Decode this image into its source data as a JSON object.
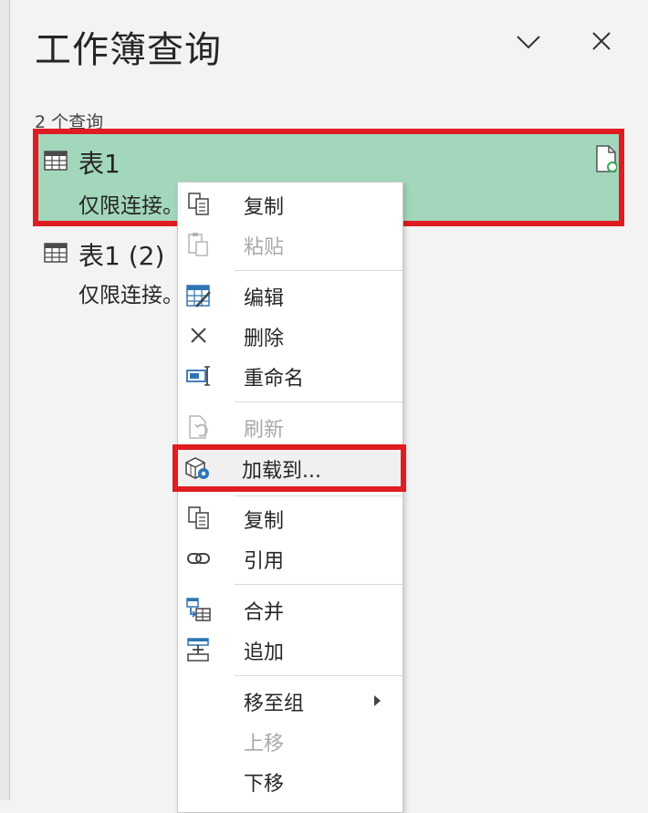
{
  "pane": {
    "title": "工作簿查询",
    "query_count": "2 个查询"
  },
  "queries": [
    {
      "name": "表1",
      "status": "仅限连接。",
      "selected": true
    },
    {
      "name": "表1 (2)",
      "status": "仅限连接。",
      "selected": false
    }
  ],
  "context_menu": {
    "items": [
      {
        "label": "复制",
        "icon": "copy-icon",
        "enabled": true
      },
      {
        "label": "粘贴",
        "icon": "paste-icon",
        "enabled": false
      },
      {
        "label": "编辑",
        "icon": "edit-table-icon",
        "enabled": true
      },
      {
        "label": "删除",
        "icon": "delete-x-icon",
        "enabled": true
      },
      {
        "label": "重命名",
        "icon": "rename-icon",
        "enabled": true
      },
      {
        "label": "刷新",
        "icon": "refresh-icon",
        "enabled": false
      },
      {
        "label": "加载到...",
        "icon": "load-to-icon",
        "enabled": true,
        "highlighted": true
      },
      {
        "label": "复制",
        "icon": "duplicate-icon",
        "enabled": true
      },
      {
        "label": "引用",
        "icon": "reference-link-icon",
        "enabled": true
      },
      {
        "label": "合并",
        "icon": "merge-icon",
        "enabled": true
      },
      {
        "label": "追加",
        "icon": "append-icon",
        "enabled": true
      },
      {
        "label": "移至组",
        "icon": "",
        "enabled": true,
        "has_submenu": true
      },
      {
        "label": "上移",
        "icon": "",
        "enabled": false
      },
      {
        "label": "下移",
        "icon": "",
        "enabled": true
      }
    ]
  },
  "colors": {
    "selected_bg": "#a3d7bb",
    "highlight_border": "#e01b22",
    "icon_blue": "#2e75b6",
    "disabled_text": "#a9a9a9"
  }
}
